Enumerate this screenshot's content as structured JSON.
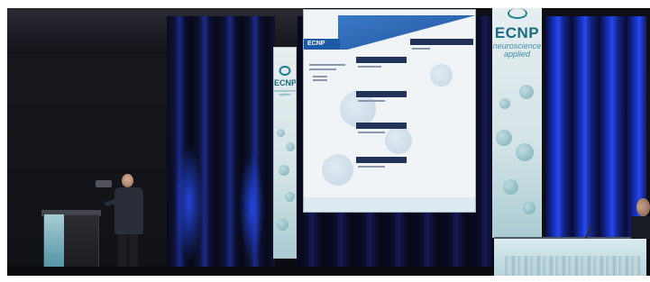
{
  "photo": {
    "colors": {
      "curtain_blue": "#2648f0",
      "banner_teal": "#1b6c82",
      "slide_header_blue": "#1c5aa8",
      "slide_bar_navy": "#22335a"
    }
  },
  "banner_left": {
    "brand": "ECNP",
    "tagline": "neuroscience applied"
  },
  "banner_right": {
    "brand": "ECNP",
    "tagline": "neuroscience applied"
  },
  "slide": {
    "logo": "ECNP"
  }
}
